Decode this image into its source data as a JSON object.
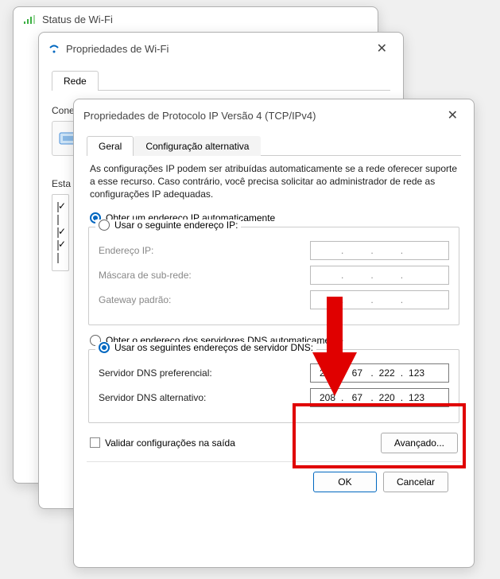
{
  "win1": {
    "title": "Status de Wi-Fi"
  },
  "win2": {
    "title": "Propriedades de Wi-Fi",
    "tab_rede": "Rede",
    "conectar_label": "Conectar-se usando:",
    "esta_label": "Esta"
  },
  "win3": {
    "title": "Propriedades de Protocolo IP Versão 4 (TCP/IPv4)",
    "tabs": {
      "geral": "Geral",
      "alt": "Configuração alternativa"
    },
    "desc": "As configurações IP podem ser atribuídas automaticamente se a rede oferecer suporte a esse recurso. Caso contrário, você precisa solicitar ao administrador de rede as configurações IP adequadas.",
    "ip_auto": "Obter um endereço IP automaticamente",
    "ip_manual": "Usar o seguinte endereço IP:",
    "ip_addr_label": "Endereço IP:",
    "mask_label": "Máscara de sub-rede:",
    "gateway_label": "Gateway padrão:",
    "dns_auto": "Obter o endereço dos servidores DNS automaticamente",
    "dns_manual": "Usar os seguintes endereços de servidor DNS:",
    "dns_pref_label": "Servidor DNS preferencial:",
    "dns_alt_label": "Servidor DNS alternativo:",
    "dns_pref": {
      "o1": "208",
      "o2": "67",
      "o3": "222",
      "o4": "123"
    },
    "dns_altv": {
      "o1": "208",
      "o2": "67",
      "o3": "220",
      "o4": "123"
    },
    "validate": "Validar configurações na saída",
    "advanced": "Avançado...",
    "ok": "OK",
    "cancel": "Cancelar"
  }
}
